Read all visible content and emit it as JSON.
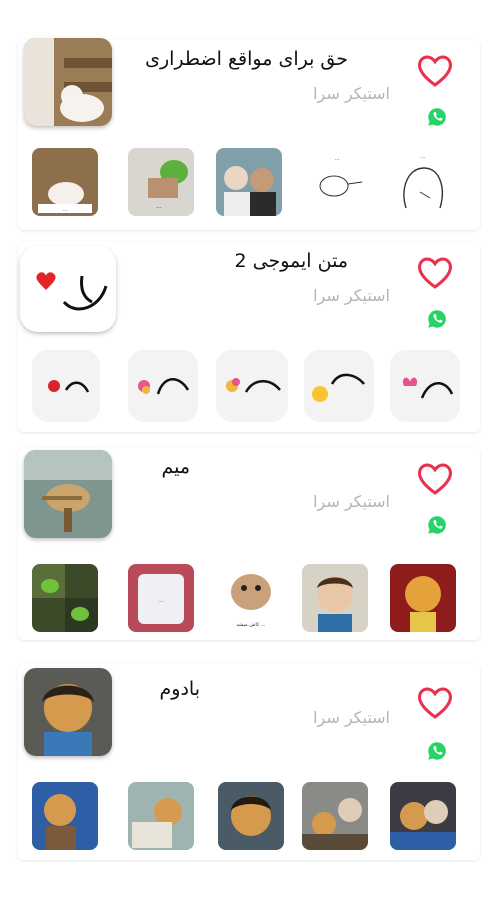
{
  "colors": {
    "heart": "#e8334f",
    "whatsapp": "#25d366",
    "subtitle": "#b4b4b4"
  },
  "packs": [
    {
      "title": "حق برای مواقع اضطراری",
      "subtitle": "استیکر سرا",
      "icons": [
        "heart-icon",
        "whatsapp-icon"
      ],
      "sticker_captions": [
        "",
        "",
        "",
        "تو ش خوایی ...",
        "بررو کی ..."
      ]
    },
    {
      "title": "متن ایموجی 2",
      "subtitle": "استیکر سرا",
      "icons": [
        "heart-icon",
        "whatsapp-icon"
      ]
    },
    {
      "title": "میم",
      "subtitle": "استیکر سرا",
      "icons": [
        "heart-icon",
        "whatsapp-icon"
      ],
      "sticker_captions": [
        "",
        "",
        "کاش میشد ...",
        "",
        ""
      ]
    },
    {
      "title": "بادوم",
      "subtitle": "استیکر سرا",
      "icons": [
        "heart-icon",
        "whatsapp-icon"
      ]
    }
  ]
}
